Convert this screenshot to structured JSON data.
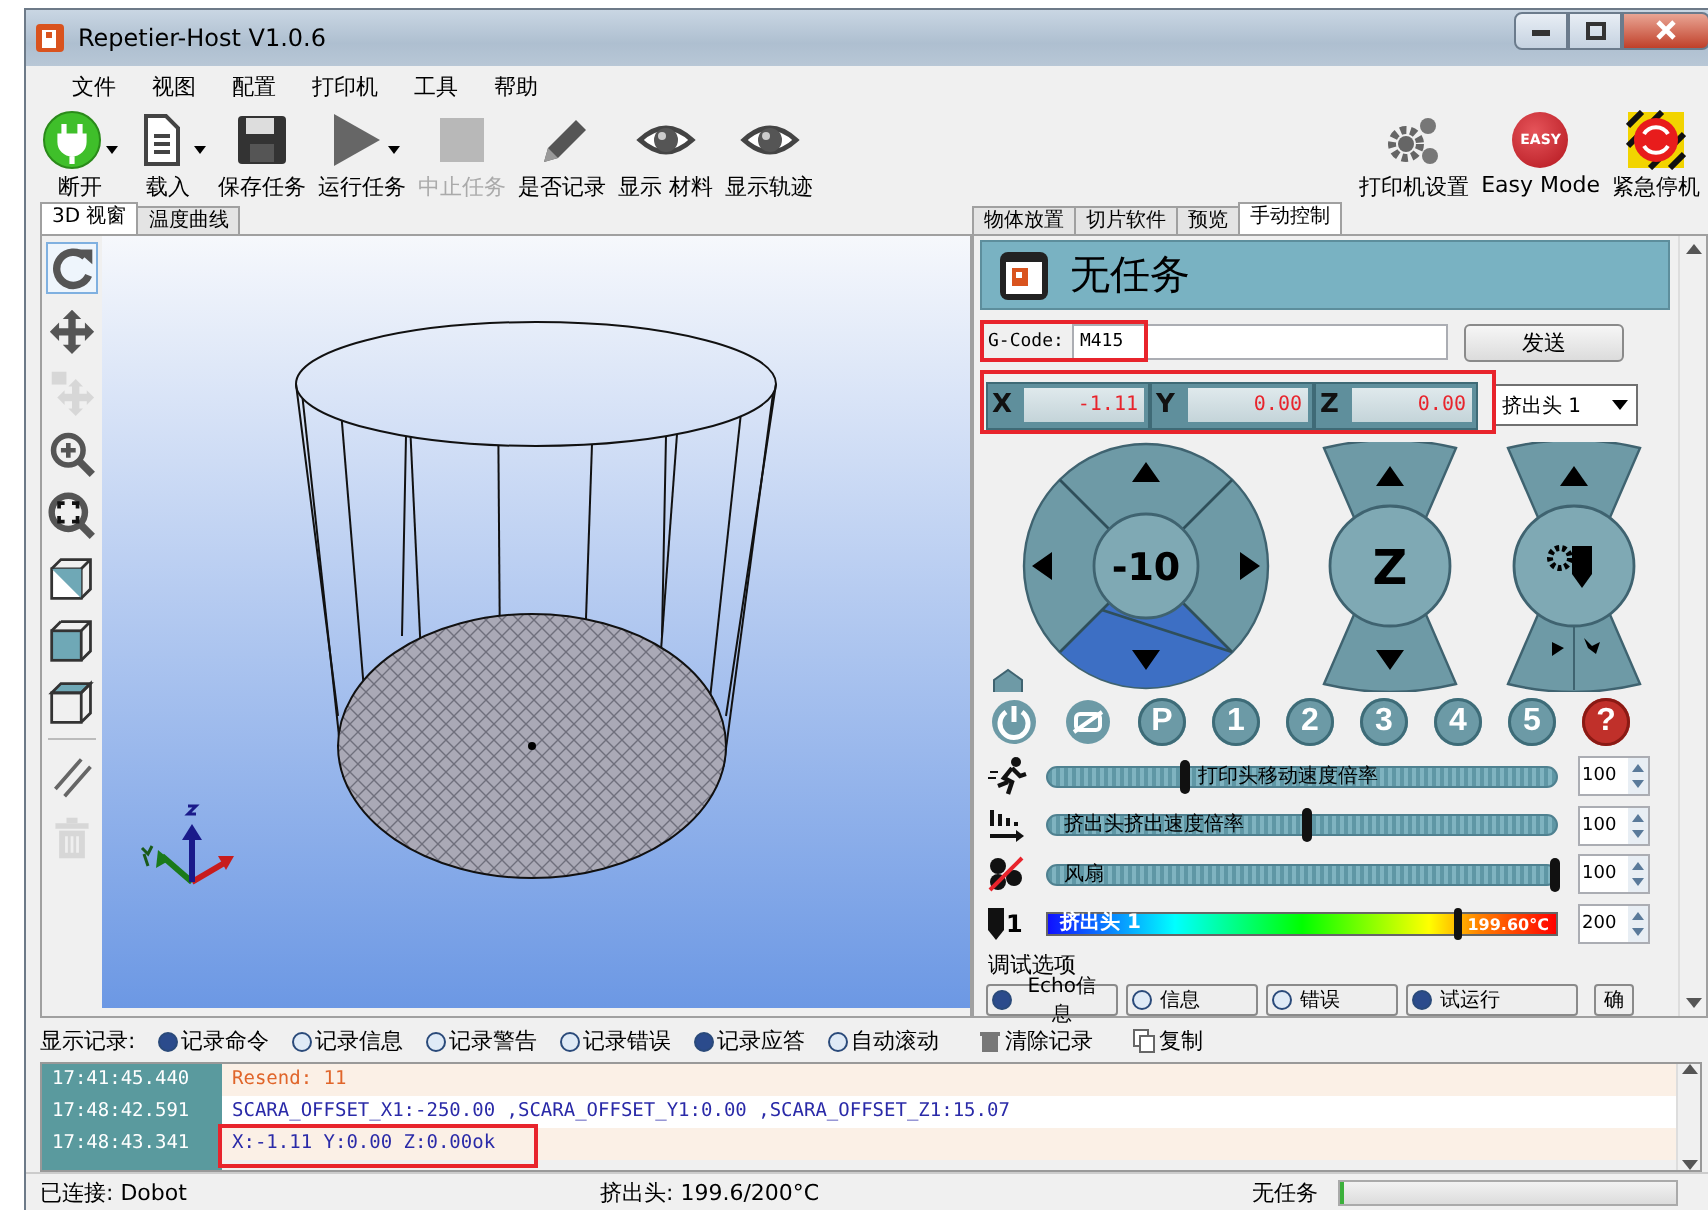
{
  "window": {
    "title": "Repetier-Host V1.0.6"
  },
  "menu": [
    "文件",
    "视图",
    "配置",
    "打印机",
    "工具",
    "帮助"
  ],
  "toolbar": {
    "left": [
      {
        "kind": "connect",
        "label": "断开",
        "dropdown": true,
        "disabled": false
      },
      {
        "kind": "load",
        "label": "载入",
        "dropdown": true,
        "disabled": false
      },
      {
        "kind": "save",
        "label": "保存任务",
        "dropdown": false,
        "disabled": false
      },
      {
        "kind": "run",
        "label": "运行任务",
        "dropdown": true,
        "disabled": false
      },
      {
        "kind": "stop",
        "label": "中止任务",
        "dropdown": false,
        "disabled": true
      },
      {
        "kind": "log",
        "label": "是否记录",
        "dropdown": false,
        "disabled": false
      },
      {
        "kind": "eye",
        "label": "显示 材料",
        "dropdown": false,
        "disabled": false
      },
      {
        "kind": "eye",
        "label": "显示轨迹",
        "dropdown": false,
        "disabled": false
      }
    ],
    "right": [
      {
        "kind": "settings",
        "label": "打印机设置"
      },
      {
        "kind": "easy",
        "label": "Easy Mode",
        "badge": "EASY"
      },
      {
        "kind": "emergency",
        "label": "紧急停机"
      }
    ]
  },
  "left_tabs": [
    {
      "label": "3D 视窗",
      "selected": true
    },
    {
      "label": "温度曲线",
      "selected": false
    }
  ],
  "view_tools": [
    {
      "kind": "rotate",
      "selected": true,
      "disabled": false
    },
    {
      "kind": "move",
      "selected": false,
      "disabled": false
    },
    {
      "kind": "move_object",
      "selected": false,
      "disabled": true
    },
    {
      "kind": "zoom",
      "selected": false,
      "disabled": false
    },
    {
      "kind": "fit",
      "selected": false,
      "disabled": false
    },
    {
      "kind": "iso",
      "selected": false,
      "disabled": false
    },
    {
      "kind": "front",
      "selected": false,
      "disabled": false
    },
    {
      "kind": "top",
      "selected": false,
      "disabled": false
    },
    {
      "kind": "parallel",
      "selected": false,
      "disabled": false
    },
    {
      "kind": "trash",
      "selected": false,
      "disabled": true
    }
  ],
  "right_tabs": [
    {
      "label": "物体放置",
      "selected": false
    },
    {
      "label": "切片软件",
      "selected": false
    },
    {
      "label": "预览",
      "selected": false
    },
    {
      "label": "手动控制",
      "selected": true
    }
  ],
  "job_header": {
    "title": "无任务"
  },
  "gcode": {
    "label": "G-Code:",
    "value": "M415",
    "button": "发送",
    "highlighted": true
  },
  "coordinates": {
    "highlighted": true,
    "axes": [
      {
        "axis": "X",
        "value": "-1.11"
      },
      {
        "axis": "Y",
        "value": "0.00"
      },
      {
        "axis": "Z",
        "value": "0.00"
      }
    ]
  },
  "extruder_select": {
    "value": "挤出头 1"
  },
  "jog": {
    "step": "-10",
    "z_label": "Z"
  },
  "quick_buttons": [
    {
      "kind": "power"
    },
    {
      "kind": "motors_off"
    },
    {
      "kind": "text",
      "label": "P"
    },
    {
      "kind": "text",
      "label": "1"
    },
    {
      "kind": "text",
      "label": "2"
    },
    {
      "kind": "text",
      "label": "3"
    },
    {
      "kind": "text",
      "label": "4"
    },
    {
      "kind": "text",
      "label": "5"
    },
    {
      "kind": "help",
      "label": "?"
    }
  ],
  "sliders": [
    {
      "kind": "speed",
      "label": "打印头移动速度倍率",
      "level": 0.27,
      "value": "100"
    },
    {
      "kind": "flow",
      "label": "挤出头挤出速度倍率",
      "level": 0.51,
      "value": "100"
    },
    {
      "kind": "fan",
      "label": "风扇",
      "level": 1,
      "value": "100"
    }
  ],
  "temperature": {
    "extruder_number": "1",
    "label": "挤出头 1",
    "reading": "199.60°C",
    "level": 0.81,
    "value": "200"
  },
  "debug": {
    "title": "调试选项",
    "options": [
      {
        "label": "Echo信息",
        "checked": true
      },
      {
        "label": "信息",
        "checked": false
      },
      {
        "label": "错误",
        "checked": false
      },
      {
        "label": "试运行",
        "checked": true
      }
    ],
    "extra_button": "确"
  },
  "log_options": {
    "label": "显示记录:",
    "items": [
      {
        "label": "记录命令",
        "checked": true
      },
      {
        "label": "记录信息",
        "checked": false
      },
      {
        "label": "记录警告",
        "checked": false
      },
      {
        "label": "记录错误",
        "checked": false
      },
      {
        "label": "记录应答",
        "checked": true
      },
      {
        "label": "自动滚动",
        "checked": false
      }
    ],
    "actions": [
      {
        "kind": "trash",
        "label": "清除记录"
      },
      {
        "kind": "copy",
        "label": "复制"
      }
    ]
  },
  "log": [
    {
      "time": "17:41:45.440",
      "text": "Resend: 11",
      "kind": "warning",
      "highlighted": false
    },
    {
      "time": "17:48:42.591",
      "text": "SCARA_OFFSET_X1:-250.00 ,SCARA_OFFSET_Y1:0.00 ,SCARA_OFFSET_Z1:15.07",
      "kind": "response",
      "highlighted": false
    },
    {
      "time": "17:48:43.341",
      "text": "X:-1.11 Y:0.00 Z:0.00ok",
      "kind": "response",
      "highlighted": true
    }
  ],
  "status_bar": {
    "connection": "已连接: Dobot",
    "extruder": "挤出头: 199.6/200°C",
    "job": "无任务",
    "progress": {
      "level": 0
    }
  }
}
